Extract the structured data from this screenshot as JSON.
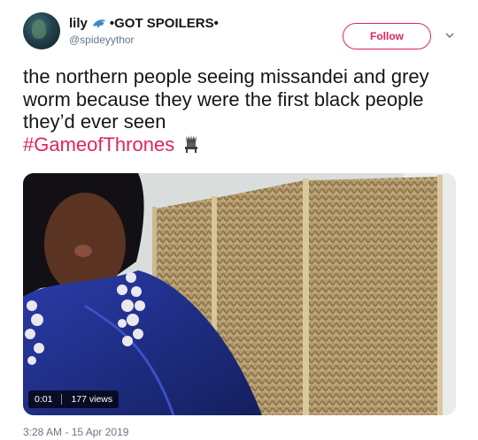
{
  "author": {
    "display_name": "lily",
    "name_suffix": "•GOT SPOILERS•",
    "handle": "@spideyythor"
  },
  "follow_label": "Follow",
  "tweet": {
    "text": "the northern people seeing missandei and grey worm because they were the first black people they’d ever seen",
    "hashtag": "#GameofThrones"
  },
  "video": {
    "duration": "0:01",
    "views": "177 views"
  },
  "timestamp": "3:28 AM - 15 Apr 2019",
  "colors": {
    "accent": "#e0245e",
    "text": "#14171a",
    "muted": "#657786"
  },
  "icons": {
    "dolphin": "dolphin-icon",
    "throne": "iron-throne-icon",
    "caret": "chevron-down-icon"
  }
}
